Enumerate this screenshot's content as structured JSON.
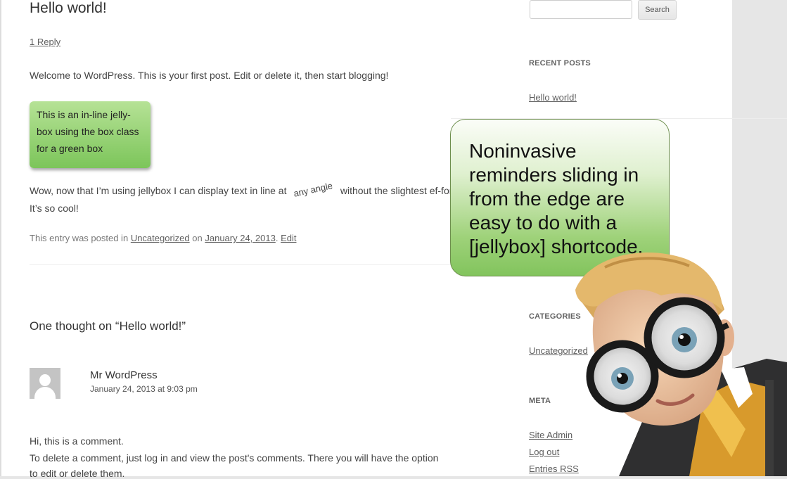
{
  "post": {
    "title": "Hello world!",
    "reply_link": "1 Reply",
    "intro": "Welcome to WordPress. This is your first post. Edit or delete it, then start blogging!",
    "greenbox_text": "This is an in-line jelly-box using the box class for a green box",
    "text_before_angle": "Wow, now that I’m using jellybox I can display text in line at",
    "angle_text": "any angle",
    "text_after_angle": "without the slightest ef-fort. It’s so cool!",
    "meta_prefix": "This entry was posted in",
    "category": "Uncategorized",
    "meta_on": "on",
    "date": "January 24, 2013",
    "edit": "Edit"
  },
  "comments": {
    "title": "One thought on “Hello world!”",
    "author": "Mr WordPress",
    "date": "January 24, 2013 at 9:03 pm",
    "line1": "Hi, this is a comment.",
    "line2": "To delete a comment, just log in and view the post's comments. There you will have the option",
    "line3": "to edit or delete them."
  },
  "sidebar": {
    "search_button": "Search",
    "recent_posts_title": "Recent Posts",
    "recent_post": "Hello world!",
    "categories_title": "Categories",
    "category": "Uncategorized",
    "meta_title": "Meta",
    "meta_links": [
      "Site Admin",
      "Log out",
      "Entries RSS"
    ]
  },
  "bubble": {
    "text": "Noninvasive reminders sliding in from the edge are easy to do with a [jellybox] shortcode."
  },
  "colors": {
    "bubble_green": "#82c45d",
    "box_green": "#7cc55a",
    "link": "#5e5e5e"
  }
}
